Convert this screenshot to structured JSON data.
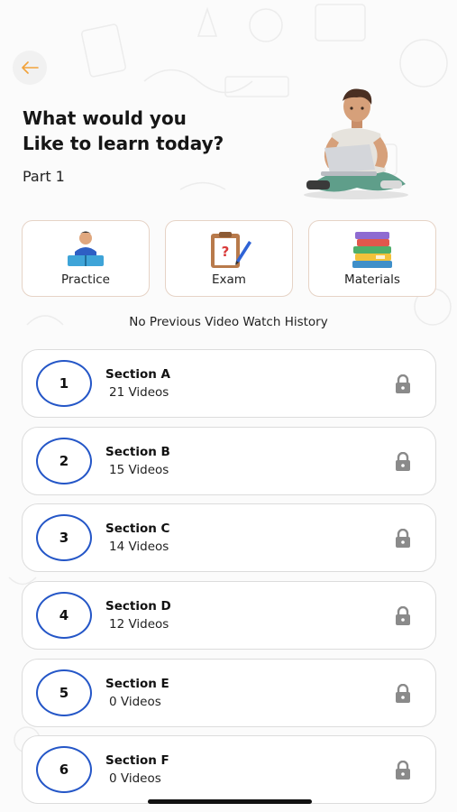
{
  "header": {
    "greeting_line1": "What would you",
    "greeting_line2": "Like to learn today?",
    "part": "Part 1"
  },
  "quick_actions": [
    {
      "label": "Practice",
      "icon": "reading-student-icon"
    },
    {
      "label": "Exam",
      "icon": "exam-clipboard-icon"
    },
    {
      "label": "Materials",
      "icon": "book-stack-icon"
    }
  ],
  "history_note": "No Previous Video Watch History",
  "sections": [
    {
      "number": "1",
      "title": "Section A",
      "count": "21 Videos"
    },
    {
      "number": "2",
      "title": "Section B",
      "count": "15 Videos"
    },
    {
      "number": "3",
      "title": "Section C",
      "count": "14 Videos"
    },
    {
      "number": "4",
      "title": "Section D",
      "count": "12 Videos"
    },
    {
      "number": "5",
      "title": "Section E",
      "count": "0 Videos"
    },
    {
      "number": "6",
      "title": "Section F",
      "count": "0 Videos"
    }
  ],
  "colors": {
    "accent": "#2456c7",
    "back_arrow": "#f2a23a",
    "card_border": "#e6d3c6",
    "lock": "#8a8a8a"
  }
}
